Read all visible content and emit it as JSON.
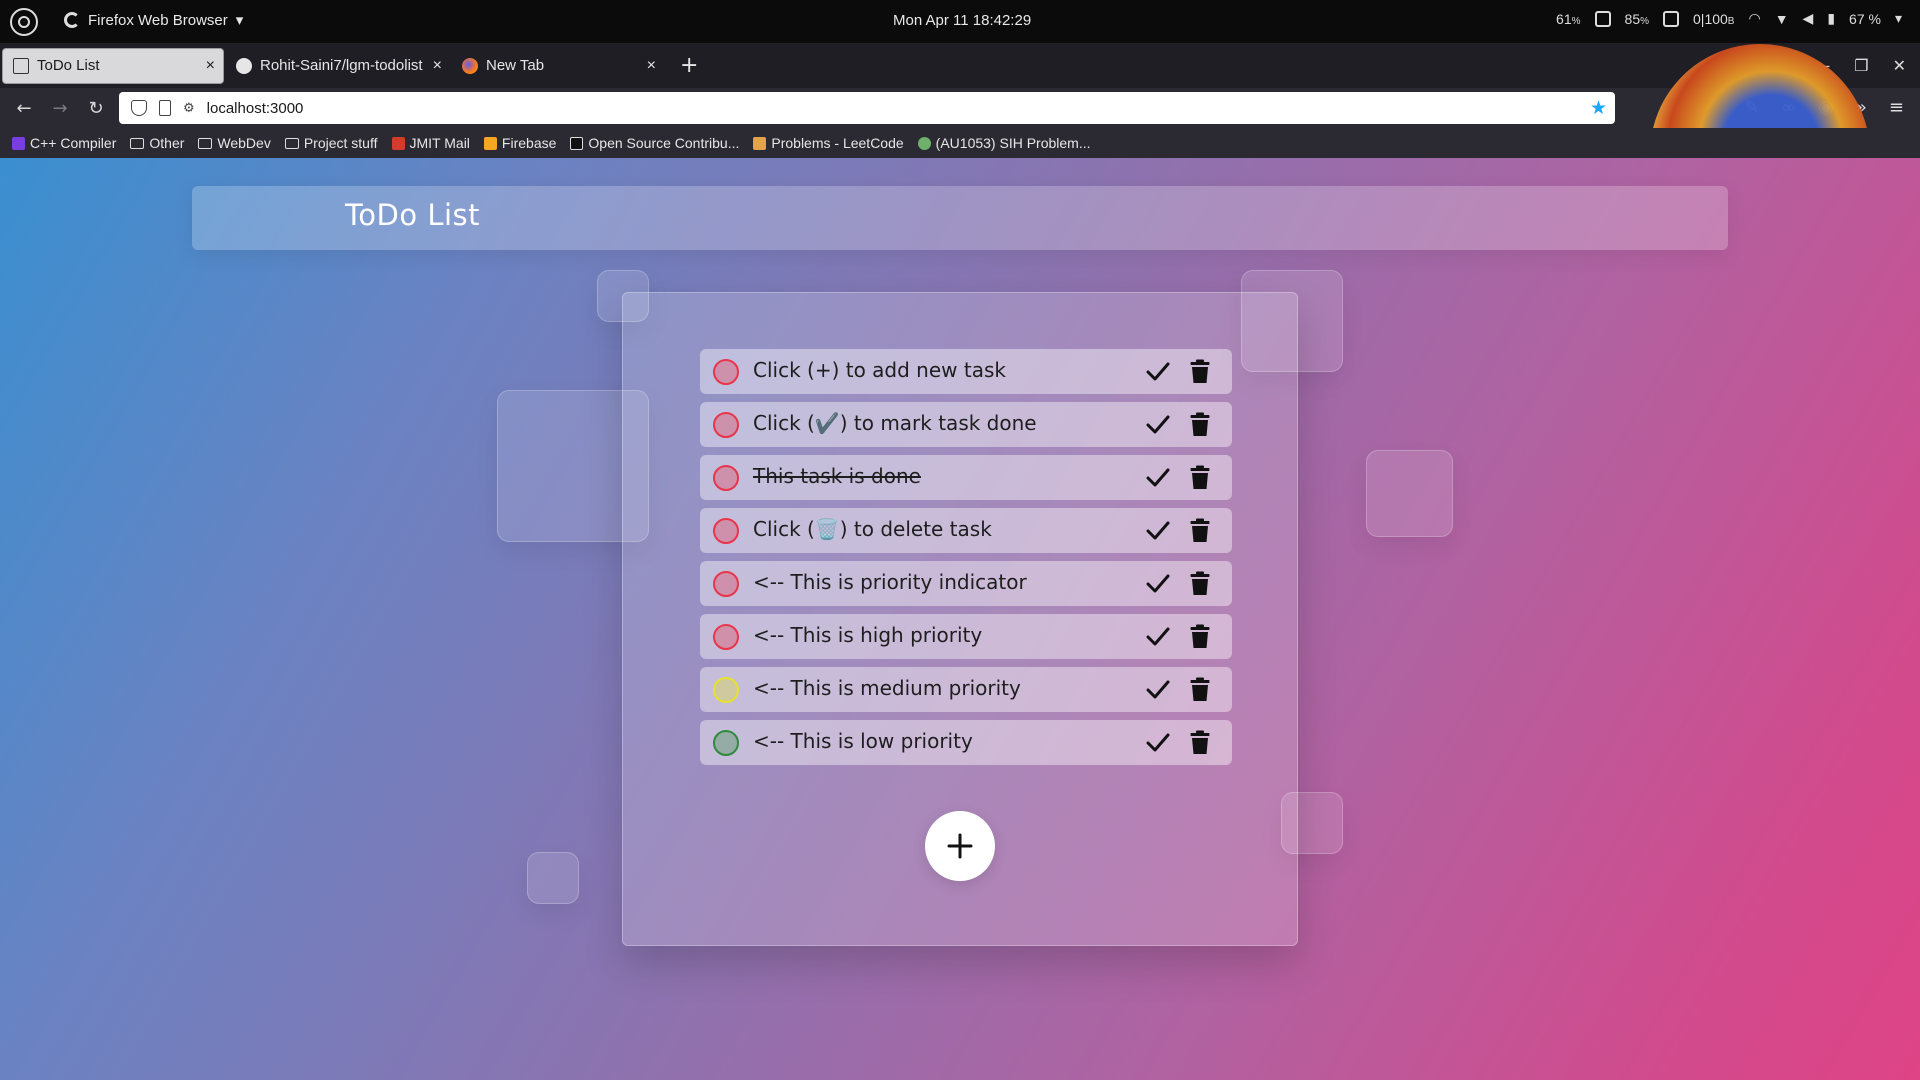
{
  "system_bar": {
    "app_name": "Firefox Web Browser",
    "clock": "Mon Apr 11  18:42:29",
    "cpu": "61",
    "mem": "85",
    "net": "0|100",
    "net_unit": "B",
    "battery": "67 %"
  },
  "browser": {
    "tabs": [
      {
        "label": "ToDo List",
        "active": true
      },
      {
        "label": "Rohit-Saini7/lgm-todolist",
        "active": false
      },
      {
        "label": "New Tab",
        "active": false
      }
    ],
    "url": "localhost:3000",
    "bookmarks": [
      {
        "label": "C++ Compiler",
        "icon": "compiler-icon",
        "color": "#7a3ee0"
      },
      {
        "label": "Other",
        "icon": "folder-icon"
      },
      {
        "label": "WebDev",
        "icon": "folder-icon"
      },
      {
        "label": "Project stuff",
        "icon": "folder-icon"
      },
      {
        "label": "JMIT Mail",
        "icon": "mail-icon",
        "color": "#d33b2c"
      },
      {
        "label": "Firebase",
        "icon": "firebase-icon",
        "color": "#f5a623"
      },
      {
        "label": "Open Source Contribu...",
        "icon": "opensource-icon",
        "color": "#222"
      },
      {
        "label": "Problems - LeetCode",
        "icon": "leetcode-icon",
        "color": "#e3a34a"
      },
      {
        "label": "(AU1053) SIH Problem...",
        "icon": "sih-icon",
        "color": "#6fb06a"
      }
    ]
  },
  "page": {
    "title": "ToDo List",
    "tasks": [
      {
        "text": "Click (+) to add new task",
        "priority": "high",
        "done": false
      },
      {
        "text": "Click (✔️) to mark task done",
        "priority": "high",
        "done": false
      },
      {
        "text": "This task is done",
        "priority": "high",
        "done": true
      },
      {
        "text": "Click (🗑️) to delete task",
        "priority": "high",
        "done": false
      },
      {
        "text": "<-- This is priority indicator",
        "priority": "high",
        "done": false
      },
      {
        "text": "<-- This is high priority",
        "priority": "high",
        "done": false
      },
      {
        "text": "<-- This is medium priority",
        "priority": "medium",
        "done": false
      },
      {
        "text": "<-- This is low priority",
        "priority": "low",
        "done": false
      }
    ],
    "priority_colors": {
      "high": "#e8354a",
      "medium": "#e6e22a",
      "low": "#2f8a3c"
    }
  }
}
